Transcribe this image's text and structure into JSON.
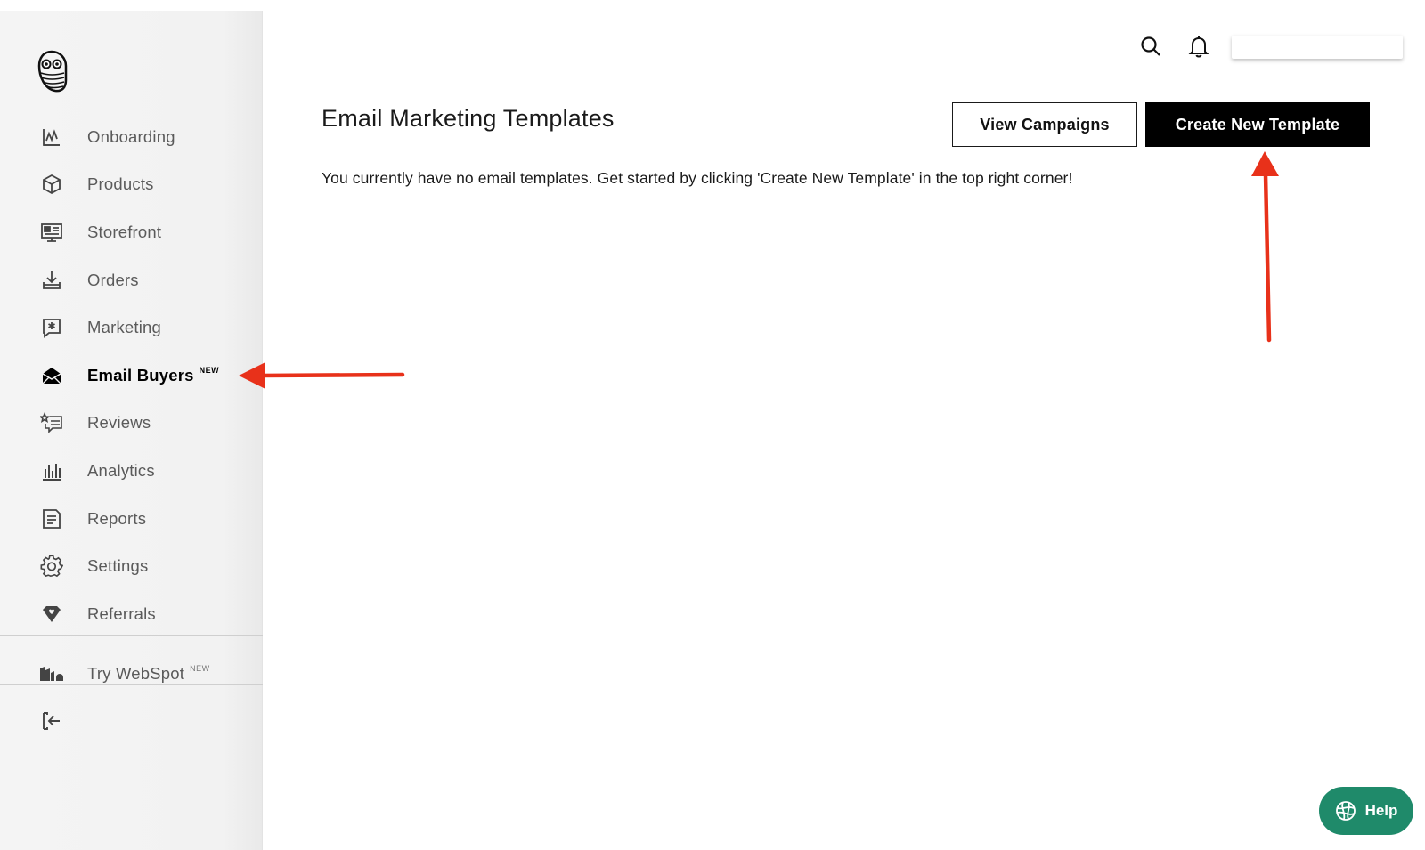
{
  "sidebar": {
    "items": [
      {
        "id": "onboarding",
        "label": "Onboarding",
        "icon": "pulse-chart-icon"
      },
      {
        "id": "products",
        "label": "Products",
        "icon": "box-icon"
      },
      {
        "id": "storefront",
        "label": "Storefront",
        "icon": "monitor-icon"
      },
      {
        "id": "orders",
        "label": "Orders",
        "icon": "download-tray-icon"
      },
      {
        "id": "marketing",
        "label": "Marketing",
        "icon": "star-message-icon"
      },
      {
        "id": "email-buyers",
        "label": "Email Buyers",
        "icon": "envelope-icon",
        "badge": "NEW",
        "active": true
      },
      {
        "id": "reviews",
        "label": "Reviews",
        "icon": "star-list-icon"
      },
      {
        "id": "analytics",
        "label": "Analytics",
        "icon": "bar-chart-icon"
      },
      {
        "id": "reports",
        "label": "Reports",
        "icon": "document-icon"
      },
      {
        "id": "settings",
        "label": "Settings",
        "icon": "gear-icon"
      },
      {
        "id": "referrals",
        "label": "Referrals",
        "icon": "heart-tag-icon"
      }
    ],
    "webspot": {
      "label": "Try WebSpot",
      "badge": "NEW",
      "icon": "buildings-icon"
    },
    "logout_icon": "logout-icon"
  },
  "header": {
    "search_icon": "search-icon",
    "notifications_icon": "bell-icon"
  },
  "main": {
    "title": "Email Marketing Templates",
    "view_campaigns_label": "View Campaigns",
    "create_template_label": "Create New Template",
    "empty_message": "You currently have no email templates. Get started by clicking 'Create New Template' in the top right corner!"
  },
  "help": {
    "label": "Help",
    "icon": "globe-icon"
  },
  "colors": {
    "annotation_arrow": "#e8311a",
    "help_bg": "#1f8a6a",
    "primary_button": "#000000"
  }
}
